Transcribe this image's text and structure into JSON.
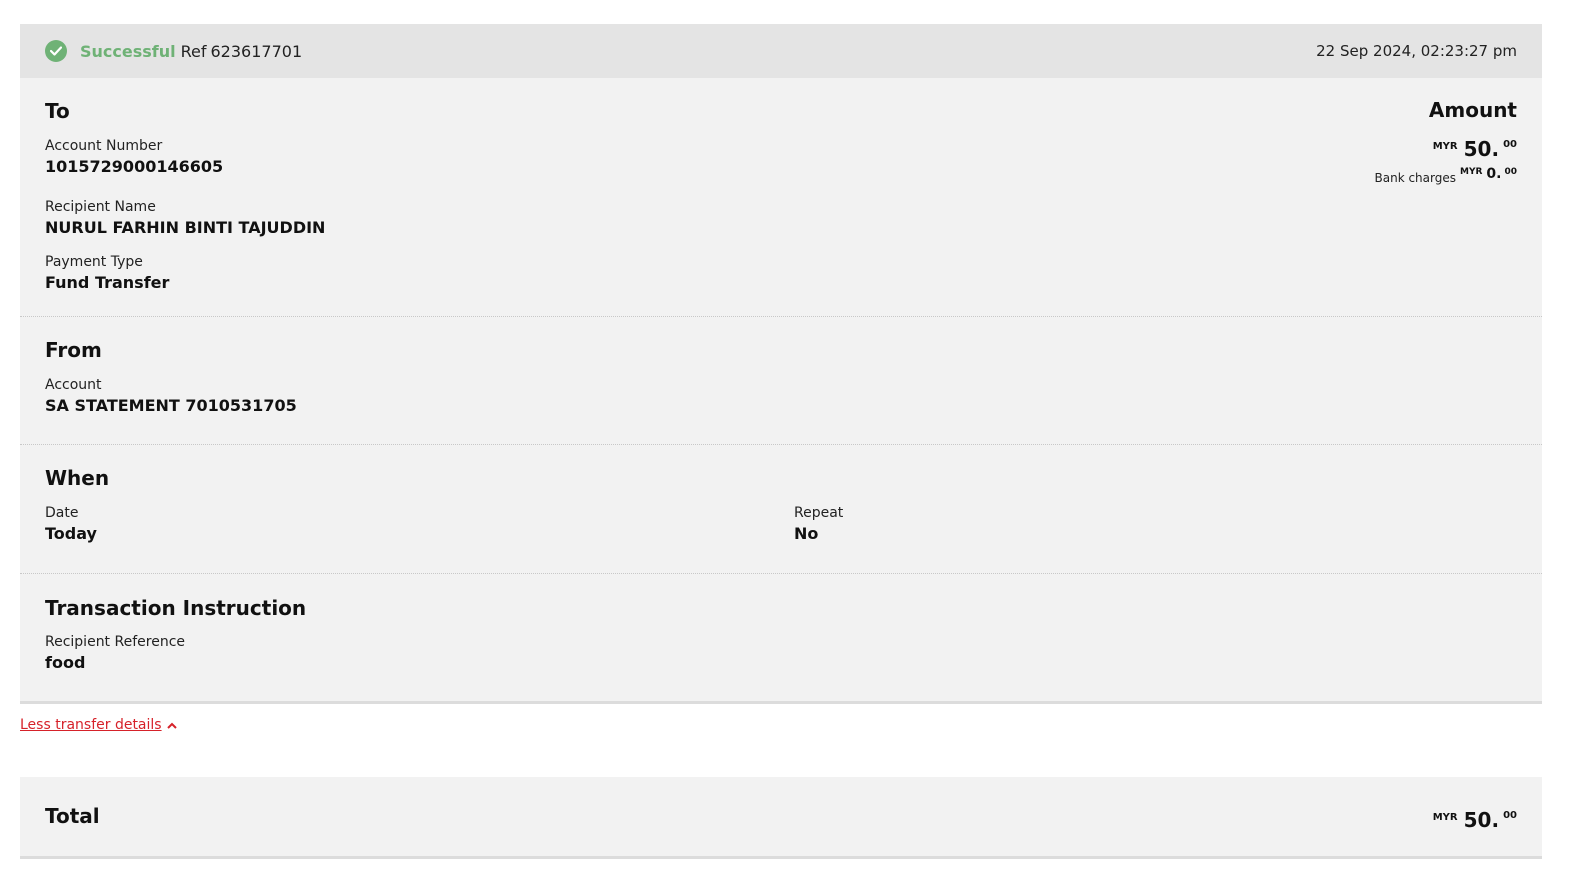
{
  "status": {
    "word": "Successful",
    "ref_label": "Ref",
    "ref_number": "623617701",
    "timestamp": "22 Sep 2024, 02:23:27 pm",
    "color": "#6fb276"
  },
  "to": {
    "title": "To",
    "account_number_label": "Account Number",
    "account_number": "1015729000146605",
    "recipient_name_label": "Recipient Name",
    "recipient_name": "NURUL FARHIN BINTI TAJUDDIN",
    "payment_type_label": "Payment Type",
    "payment_type": "Fund Transfer"
  },
  "amount": {
    "title": "Amount",
    "currency": "MYR",
    "whole": "50.",
    "cents": "00",
    "bank_charges_label": "Bank charges",
    "bank_charges_currency": "MYR",
    "bank_charges_whole": "0.",
    "bank_charges_cents": "00"
  },
  "from": {
    "title": "From",
    "account_label": "Account",
    "account": "SA STATEMENT 7010531705"
  },
  "when": {
    "title": "When",
    "date_label": "Date",
    "date": "Today",
    "repeat_label": "Repeat",
    "repeat": "No"
  },
  "instruction": {
    "title": "Transaction Instruction",
    "recipient_reference_label": "Recipient Reference",
    "recipient_reference": "food"
  },
  "toggle_link": {
    "label": "Less transfer details",
    "color": "#d6222a"
  },
  "total": {
    "title": "Total",
    "currency": "MYR",
    "whole": "50.",
    "cents": "00"
  }
}
